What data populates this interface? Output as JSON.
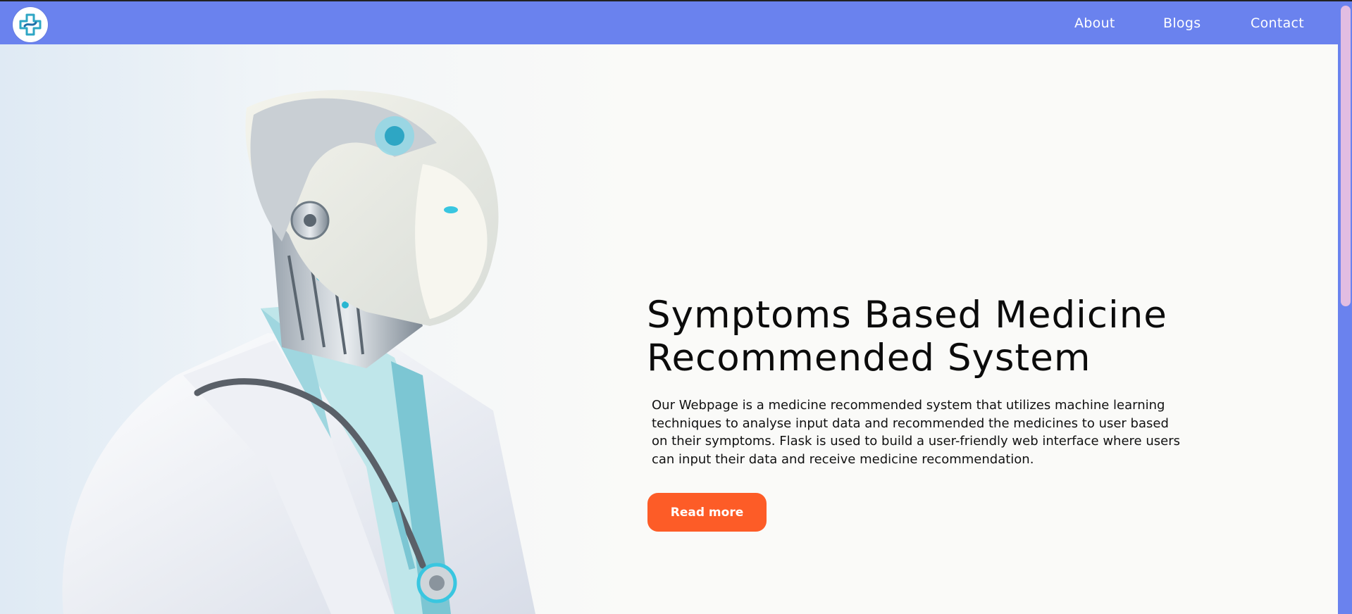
{
  "colors": {
    "navbar": "#6a82ee",
    "cta": "#fd5c27",
    "background": "#fafaf8",
    "scrollbar_thumb": "#e2bde2"
  },
  "header": {
    "logo_icon": "medical-cross-icon",
    "nav_links": [
      {
        "label": "About"
      },
      {
        "label": "Blogs"
      },
      {
        "label": "Contact"
      }
    ]
  },
  "hero": {
    "image": "robot-doctor-illustration",
    "title_line1": "Symptoms Based Medicine",
    "title_line2": "Recommended System",
    "description": "Our Webpage is a medicine recommended system that utilizes machine learning techniques to analyse input data and recommended the medicines to user based on their symptoms. Flask is used to build a user-friendly web interface where users can input their data and receive medicine recommendation.",
    "cta_label": "Read more"
  }
}
